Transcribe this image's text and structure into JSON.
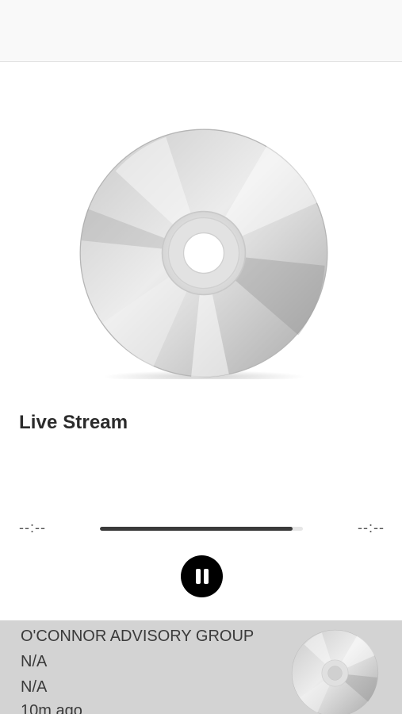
{
  "player": {
    "track_title": "Live Stream",
    "elapsed": "--:--",
    "remaining": "--:--",
    "progress_fraction": 0.95,
    "state": "playing",
    "toggle_icon": "pause-icon"
  },
  "recent": {
    "station": "O'CONNOR ADVISORY GROUP",
    "artist": "N/A",
    "song": "N/A",
    "time_ago": "10m ago"
  },
  "colors": {
    "progress_fill": "#3a3a3a",
    "progress_track": "#e6e6e6",
    "history_background": "#d3d3d3",
    "toggle_button": "#000000"
  }
}
